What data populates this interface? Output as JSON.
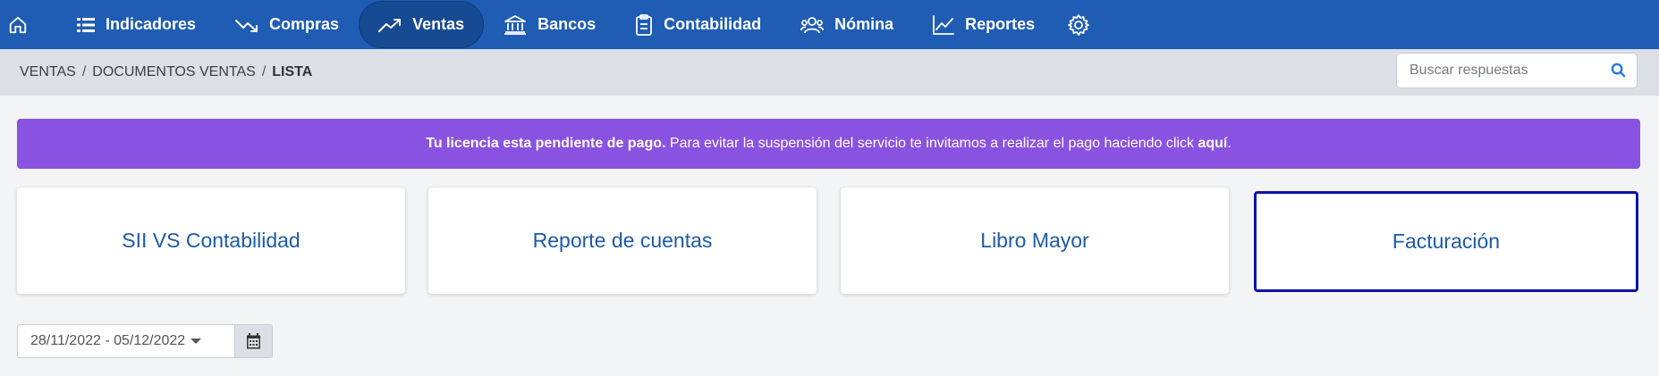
{
  "nav": {
    "items": [
      {
        "label": "Indicadores",
        "icon": "list-icon"
      },
      {
        "label": "Compras",
        "icon": "trend-down-icon"
      },
      {
        "label": "Ventas",
        "icon": "trend-up-icon",
        "active": true
      },
      {
        "label": "Bancos",
        "icon": "bank-icon"
      },
      {
        "label": "Contabilidad",
        "icon": "clipboard-icon"
      },
      {
        "label": "Nómina",
        "icon": "users-icon"
      },
      {
        "label": "Reportes",
        "icon": "chart-line-icon"
      }
    ],
    "home_icon": "home-icon",
    "settings_icon": "gear-icon"
  },
  "breadcrumb": {
    "items": [
      "VENTAS",
      "DOCUMENTOS VENTAS"
    ],
    "current": "LISTA",
    "separator": "/"
  },
  "search": {
    "placeholder": "Buscar respuestas",
    "value": ""
  },
  "alert": {
    "strong": "Tu licencia esta pendiente de pago.",
    "text": " Para evitar la suspensión del servicio te invitamos a realizar el pago haciendo click ",
    "link": "aquí",
    "end": "."
  },
  "cards": [
    {
      "label": "SII VS Contabilidad"
    },
    {
      "label": "Reporte de cuentas"
    },
    {
      "label": "Libro Mayor"
    },
    {
      "label": "Facturación",
      "selected": true
    }
  ],
  "date_range": {
    "value": "28/11/2022 - 05/12/2022"
  },
  "colors": {
    "navbar": "#1f5cb4",
    "alert": "#8a52e0",
    "card_text": "#1e5aa8",
    "selected_border": "#0d13a6"
  }
}
